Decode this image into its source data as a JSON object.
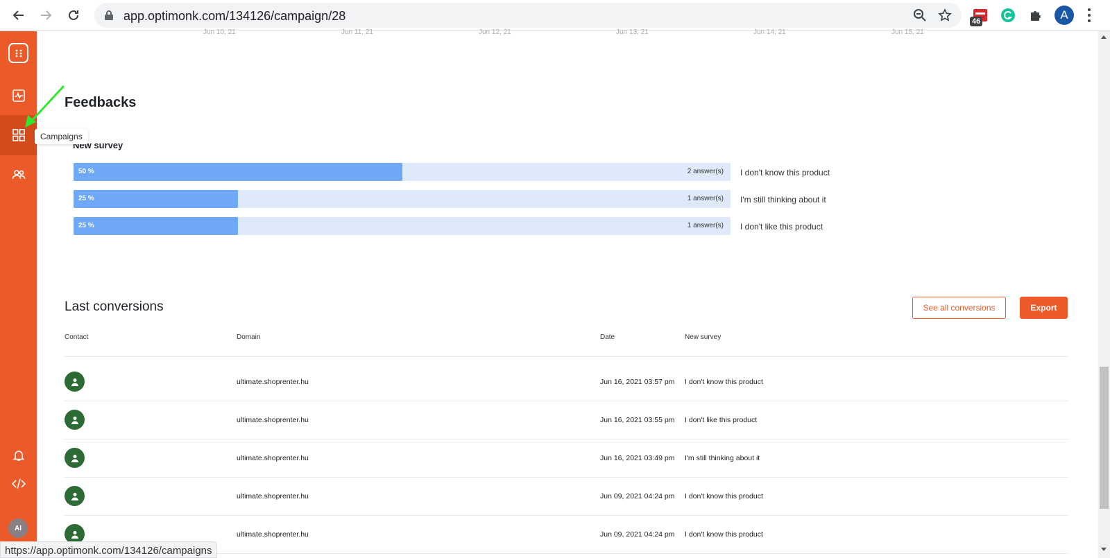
{
  "browser": {
    "url": "app.optimonk.com/134126/campaign/28",
    "ext_badge": "46",
    "profile_initial": "A"
  },
  "sidebar": {
    "tooltip": "Campaigns",
    "user_initials": "AI",
    "accent_color": "#ed5a29"
  },
  "chart_axis": {
    "dates": [
      "Jun 10, 21",
      "Jun 11, 21",
      "Jun 12, 21",
      "Jun 13, 21",
      "Jun 14, 21",
      "Jun 15, 21"
    ]
  },
  "feedbacks": {
    "title": "Feedbacks",
    "survey_title": "New survey",
    "rows": [
      {
        "percent_label": "50 %",
        "answers": "2 answer(s)",
        "label": "I don't know this product",
        "fraction": 0.5
      },
      {
        "percent_label": "25 %",
        "answers": "1 answer(s)",
        "label": "I'm still thinking about it",
        "fraction": 0.25
      },
      {
        "percent_label": "25 %",
        "answers": "1 answer(s)",
        "label": "I don't like this product",
        "fraction": 0.25
      }
    ]
  },
  "conversions": {
    "title": "Last conversions",
    "see_all_label": "See all conversions",
    "export_label": "Export",
    "columns": [
      "Contact",
      "Domain",
      "Date",
      "New survey"
    ],
    "rows": [
      {
        "domain": "ultimate.shoprenter.hu",
        "date": "Jun 16, 2021 03:57 pm",
        "answer": "I don't know this product"
      },
      {
        "domain": "ultimate.shoprenter.hu",
        "date": "Jun 16, 2021 03:55 pm",
        "answer": "I don't like this product"
      },
      {
        "domain": "ultimate.shoprenter.hu",
        "date": "Jun 16, 2021 03:49 pm",
        "answer": "I'm still thinking about it"
      },
      {
        "domain": "ultimate.shoprenter.hu",
        "date": "Jun 09, 2021 04:24 pm",
        "answer": "I don't know this product"
      },
      {
        "domain": "ultimate.shoprenter.hu",
        "date": "Jun 09, 2021 04:24 pm",
        "answer": "I don't know this product"
      }
    ]
  },
  "statusbar": {
    "link": "https://app.optimonk.com/134126/campaigns"
  }
}
